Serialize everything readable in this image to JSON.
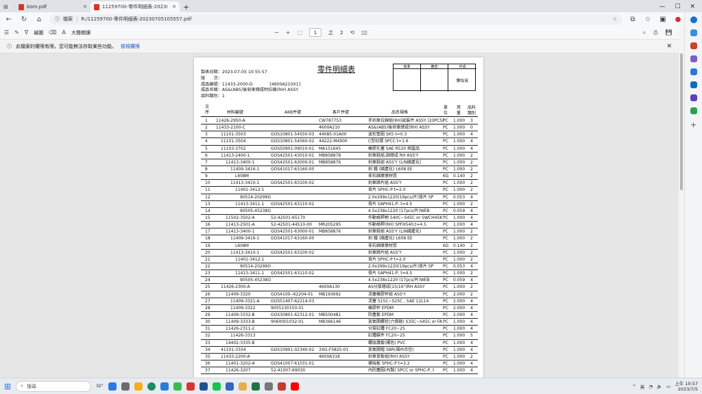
{
  "tabs": [
    {
      "title": "bom.pdf",
      "active": false
    },
    {
      "title": "11259700-零件明細表-20230705...",
      "active": true
    }
  ],
  "address": {
    "label": "檔案",
    "url": "R:/11259700-零件明細表-20230705105557.pdf"
  },
  "toolbar": {
    "draw_label": "繪圖",
    "readaloud_label": "大聲朗讀",
    "page_current": "1",
    "page_total": "2"
  },
  "infobar": {
    "message": "此檔案的權限有限，您可能無法存取某些功能。",
    "link": "檢視權限"
  },
  "document": {
    "title": "零件明細表",
    "meta": [
      "製表日期：2023-07-05 10:55:57",
      "版　　次：",
      "成品編號：11433-2000-D　　　　[4600A210X1]",
      "成品名稱：AS&(ABS)後剎車總成附拉線(RH) ASSY",
      "品料類別：1"
    ],
    "sign": {
      "h1": "核准",
      "h2": "審查",
      "h3": "作成",
      "maker": "葉怡安"
    },
    "headers": {
      "seq_a": "次",
      "seq_b": "序",
      "part": "材料編號",
      "akb": "AKB件號",
      "cust": "客戶件號",
      "name": "品名規格",
      "unit_a": "單",
      "unit_b": "位",
      "qty_a": "用",
      "qty_b": "量",
      "cat_a": "品料",
      "cat_b": "類別"
    },
    "rows": [
      {
        "no": "1",
        "indent": 0,
        "part": "11426-2950-A",
        "akb": "",
        "cust": "CW787753",
        "name": "手剎車拉線組(RH)試裝件 ASSY (20PCS)",
        "unit": "PC",
        "qty": "1.000",
        "cat": "3"
      },
      {
        "no": "2",
        "indent": 0,
        "part": "11433-2100-C",
        "akb": "",
        "cust": "4600A210",
        "name": "AS&(ABS)後剎車總成(RH) ASSY",
        "unit": "PC",
        "qty": "1.000",
        "cat": "0"
      },
      {
        "no": "3",
        "indent": 1,
        "part": "11101-3503",
        "akb": "GOS10801-54550-03",
        "cust": "44085-01A00",
        "name": "波形墊圈 SK5 t=0.3",
        "unit": "PC",
        "qty": "1.000",
        "cat": "4"
      },
      {
        "no": "4",
        "indent": 1,
        "part": "11101-3504",
        "akb": "GOS10801-54560-02",
        "cust": "44222-M4900",
        "name": "C型扣環 SPCC t=1.6",
        "unit": "PC",
        "qty": "1.000",
        "cat": "4"
      },
      {
        "no": "5",
        "indent": 1,
        "part": "11103-3702",
        "akb": "GOS50901-09010-01",
        "cust": "MA151645",
        "name": "橡膠孔塞 SAE R520 相當品",
        "unit": "PC",
        "qty": "1.000",
        "cat": "4"
      },
      {
        "no": "6",
        "indent": 1,
        "part": "11413-2400-1",
        "akb": "GOS42501-43010-01",
        "cust": "MB858878",
        "name": "剎車鞋組,調總成 RH ASS'Y",
        "unit": "PC",
        "qty": "1.000",
        "cat": "2"
      },
      {
        "no": "7",
        "indent": 2,
        "part": "11413-3400-1",
        "akb": "GOS42501-63000-01",
        "cust": "MB858876",
        "name": "剎車鞋組 ASS'Y (L/N國產化)",
        "unit": "PC",
        "qty": "1.000",
        "cat": "2"
      },
      {
        "no": "8",
        "indent": 3,
        "part": "11409-3416-1",
        "akb": "GOS41017-63160-00",
        "cust": "",
        "name": "剎 鐵 (國產化) L608 EE",
        "unit": "PC",
        "qty": "1.000",
        "cat": "2"
      },
      {
        "no": "9",
        "indent": 4,
        "part": "L608M",
        "akb": "",
        "cust": "",
        "name": "非石綿摩擦材質",
        "unit": "KG",
        "qty": "0.140",
        "cat": "2"
      },
      {
        "no": "10",
        "indent": 3,
        "part": "11413-3410-1",
        "akb": "GOS42501-63100-02",
        "cust": "",
        "name": "剎車蹄片組 ASS'Y",
        "unit": "PC",
        "qty": "1.000",
        "cat": "2"
      },
      {
        "no": "11",
        "indent": 4,
        "part": "11401-3412-1",
        "akb": "",
        "cust": "",
        "name": "背片 SPHC-P t=2.0",
        "unit": "PC",
        "qty": "1.000",
        "cat": "2"
      },
      {
        "no": "12",
        "indent": 5,
        "part": "90514-20299O",
        "akb": "",
        "cust": "",
        "name": "2.0x299x1220(19pcs/片)背片 SP",
        "unit": "PC",
        "qty": "0.053",
        "cat": "4"
      },
      {
        "no": "13",
        "indent": 4,
        "part": "11413-3411-1",
        "akb": "GOS42501-63110-02",
        "cust": "",
        "name": "骨片 SAPH41-P, t=4.5",
        "unit": "PC",
        "qty": "1.000",
        "cat": "2"
      },
      {
        "no": "14",
        "indent": 5,
        "part": "90505-45238O",
        "akb": "",
        "cust": "",
        "name": "4.5x238x1220 (17pcs/片)WEB",
        "unit": "PC",
        "qty": "0.059",
        "cat": "4"
      },
      {
        "no": "15",
        "indent": 2,
        "part": "11502-3502-A",
        "akb": "52-42501-65170",
        "cust": "",
        "name": "作動槓桿柄 S40C~S45C or SWCH45K",
        "unit": "PC",
        "qty": "1.000",
        "cat": "4"
      },
      {
        "no": "16",
        "indent": 2,
        "part": "11413-2501-A",
        "akb": "52-42501-44510-00",
        "cust": "MR205295",
        "name": "作動槓桿(RH) SPFH540,t=4.5",
        "unit": "PC",
        "qty": "1.000",
        "cat": "4"
      },
      {
        "no": "17",
        "indent": 2,
        "part": "11413-3400-1",
        "akb": "GOS42501-63000-01",
        "cust": "MB858876",
        "name": "剎車鞋組 ASS'Y (L/N國產化)",
        "unit": "PC",
        "qty": "1.000",
        "cat": "2"
      },
      {
        "no": "18",
        "indent": 3,
        "part": "11409-3416-1",
        "akb": "GOS41017-63160-00",
        "cust": "",
        "name": "剎 鐵 (國產化) L608 EE",
        "unit": "PC",
        "qty": "1.000",
        "cat": "2"
      },
      {
        "no": "19",
        "indent": 4,
        "part": "L608M",
        "akb": "",
        "cust": "",
        "name": "非石綿摩擦材質",
        "unit": "KG",
        "qty": "0.140",
        "cat": "2"
      },
      {
        "no": "20",
        "indent": 3,
        "part": "11413-3410-1",
        "akb": "GOS42501-63100-02",
        "cust": "",
        "name": "剎車蹄片組 ASS'Y",
        "unit": "PC",
        "qty": "1.000",
        "cat": "2"
      },
      {
        "no": "21",
        "indent": 4,
        "part": "11401-3412-1",
        "akb": "",
        "cust": "",
        "name": "背片 SPHC-P t=2.0",
        "unit": "PC",
        "qty": "1.000",
        "cat": "2"
      },
      {
        "no": "22",
        "indent": 5,
        "part": "90514-20299O",
        "akb": "",
        "cust": "",
        "name": "2.0x299x1220(19pcs/片)背片 SP",
        "unit": "PC",
        "qty": "0.053",
        "cat": "4"
      },
      {
        "no": "23",
        "indent": 4,
        "part": "11413-3411-1",
        "akb": "GOS42501-63110-02",
        "cust": "",
        "name": "骨片 SAPH41-P, t=4.5",
        "unit": "PC",
        "qty": "1.000",
        "cat": "2"
      },
      {
        "no": "24",
        "indent": 5,
        "part": "90505-45238O",
        "akb": "",
        "cust": "",
        "name": "4.5x238x1220 (17pcs/片)WEB",
        "unit": "PC",
        "qty": "0.059",
        "cat": "4"
      },
      {
        "no": "25",
        "indent": 1,
        "part": "11426-2300-A",
        "akb": "",
        "cust": "4600A130",
        "name": "AS分泵總成(15/16\")RH ASSY",
        "unit": "PC",
        "qty": "1.000",
        "cat": "2"
      },
      {
        "no": "26",
        "indent": 2,
        "part": "11409-3320",
        "akb": "GOS4100--62204-01",
        "cust": "MB193692",
        "name": "活塞橡膠杯組 ASS'Y",
        "unit": "PC",
        "qty": "2.000",
        "cat": "2"
      },
      {
        "no": "27",
        "indent": 3,
        "part": "11409-3321-A",
        "akb": "GOS51407-62214-03",
        "cust": "",
        "name": "活塞 S15C~S25C , SAE 12L14",
        "unit": "PC",
        "qty": "2.000",
        "cat": "4"
      },
      {
        "no": "28",
        "indent": 3,
        "part": "11409-3322",
        "akb": "9055130150-01",
        "cust": "",
        "name": "橡膠杯 EPDM",
        "unit": "PC",
        "qty": "2.000",
        "cat": "4"
      },
      {
        "no": "29",
        "indent": 2,
        "part": "11409-3332-B",
        "akb": "GOS30801-62312-01",
        "cust": "MB500481",
        "name": "防塵套 EPDM",
        "unit": "PC",
        "qty": "2.000",
        "cat": "4"
      },
      {
        "no": "30",
        "indent": 2,
        "part": "11409-3333-B",
        "akb": "9060001032-01",
        "cust": "MB366146",
        "name": "放氣閥螺栓(六價鉻) S35C~S45C or FA",
        "unit": "PC",
        "qty": "1.000",
        "cat": "4"
      },
      {
        "no": "31",
        "indent": 2,
        "part": "11426-2311-2",
        "akb": "",
        "cust": "",
        "name": "分泵缸體 FC20~25",
        "unit": "PC",
        "qty": "1.000",
        "cat": "4"
      },
      {
        "no": "32",
        "indent": 3,
        "part": "11426-3313",
        "akb": "",
        "cust": "",
        "name": "缸體鑄件 FC20~25",
        "unit": "PC",
        "qty": "1.000",
        "cat": "5"
      },
      {
        "no": "33",
        "indent": 2,
        "part": "14402-3335-B",
        "akb": "",
        "cust": "",
        "name": "螺紋護套(橘色) PVC",
        "unit": "PC",
        "qty": "1.000",
        "cat": "4"
      },
      {
        "no": "34",
        "indent": 1,
        "part": "41101-3334",
        "akb": "GOS10901-02340-02",
        "cust": "3XG-F5825-01",
        "name": "放氣閥帽 SBR(福州合信)",
        "unit": "PC",
        "qty": "1.000",
        "cat": "4"
      },
      {
        "no": "35",
        "indent": 1,
        "part": "11433-2200-A",
        "akb": "",
        "cust": "4600A318",
        "name": "剎車背板組(RH) ASSY",
        "unit": "PC",
        "qty": "1.000",
        "cat": "2"
      },
      {
        "no": "36",
        "indent": 2,
        "part": "11401-3202-A",
        "akb": "GOS41007-61031-01",
        "cust": "",
        "name": "補強板 SPHC-P t=3.2",
        "unit": "PC",
        "qty": "1.000",
        "cat": "4"
      },
      {
        "no": "37",
        "indent": 2,
        "part": "11426-3207",
        "akb": "52-41007-69030",
        "cust": "",
        "name": "內防塵圈(內製) SPCC or SPHC-P, t",
        "unit": "PC",
        "qty": "1.000",
        "cat": "4"
      }
    ]
  },
  "taskbar": {
    "search_placeholder": "搜尋",
    "weather_temp": "32°",
    "lang_a": "英",
    "lang_b": "英",
    "time": "上午 10:57",
    "date": "2023/7/5"
  }
}
